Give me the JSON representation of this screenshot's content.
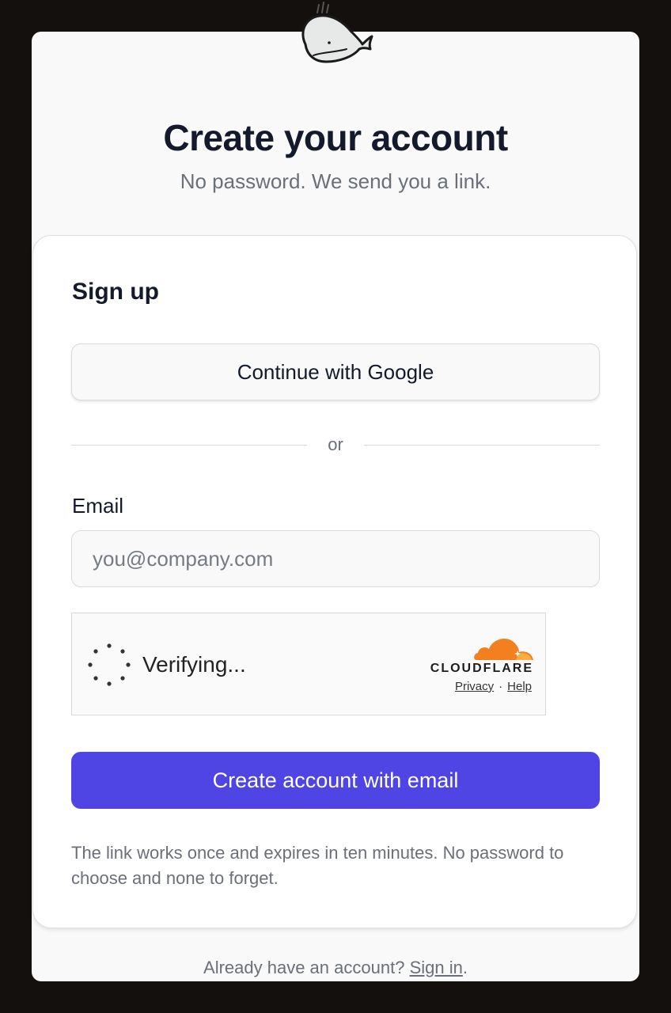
{
  "header": {
    "logo_icon": "whale-icon",
    "title": "Create your account",
    "subtitle": "No password. We send you a link."
  },
  "signup": {
    "title": "Sign up",
    "google_button_label": "Continue with Google",
    "divider_text": "or",
    "email_label": "Email",
    "email_placeholder": "you@company.com",
    "email_value": "",
    "submit_label": "Create account with email",
    "note": "The link works once and expires in ten minutes. No password to choose and none to forget."
  },
  "captcha": {
    "status": "Verifying...",
    "provider": "CLOUDFLARE",
    "privacy_label": "Privacy",
    "separator": "·",
    "help_label": "Help",
    "brand_color": "#f38020"
  },
  "footer": {
    "prompt": "Already have an account?",
    "signin_label": "Sign in",
    "trailing": "."
  },
  "colors": {
    "primary": "#4e45e4",
    "text": "#141a2b",
    "muted": "#6b6f78"
  }
}
